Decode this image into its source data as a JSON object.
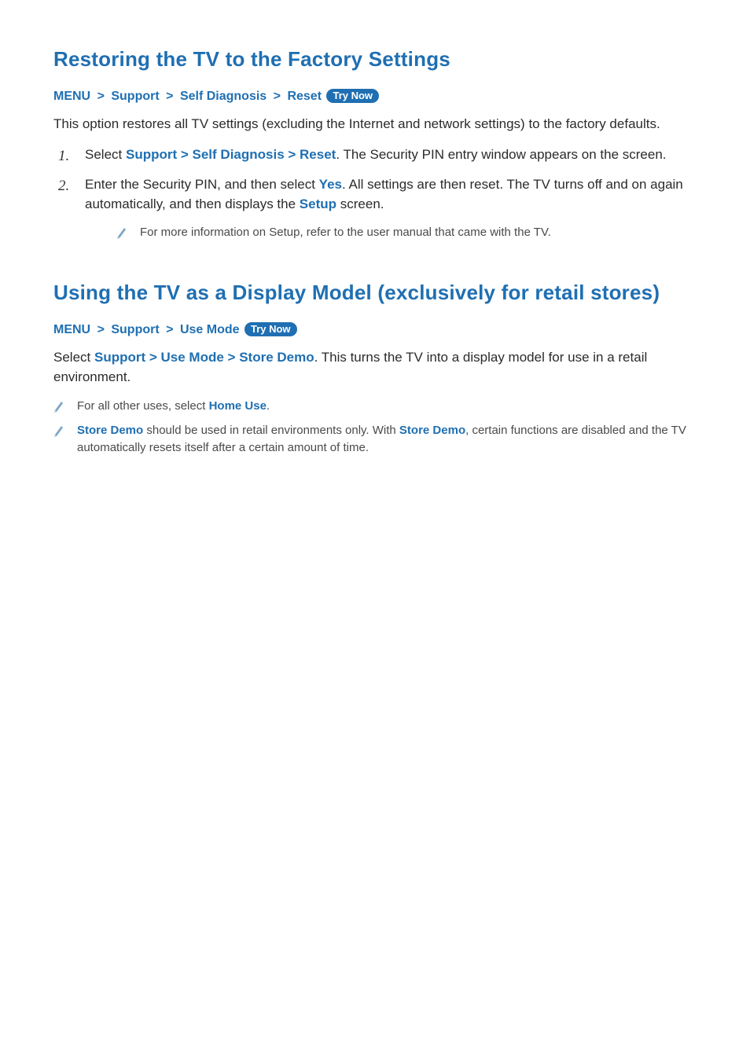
{
  "section1": {
    "title": "Restoring the TV to the Factory Settings",
    "menu_label": "MENU",
    "path_item1": "Support",
    "path_item2": "Self Diagnosis",
    "path_item3": "Reset",
    "trynow": "Try Now",
    "intro": "This option restores all TV settings (excluding the Internet and network settings) to the factory defaults.",
    "step1_pre": "Select ",
    "step1_kw1": "Support",
    "step1_kw2": "Self Diagnosis",
    "step1_kw3": "Reset",
    "step1_post": ". The Security PIN entry window appears on the screen.",
    "step2_pre": "Enter the Security PIN, and then select ",
    "step2_kw1": "Yes",
    "step2_mid": ". All settings are then reset. The TV turns off and on again automatically, and then displays the ",
    "step2_kw2": "Setup",
    "step2_post": " screen.",
    "note1": "For more information on Setup, refer to the user manual that came with the TV."
  },
  "section2": {
    "title": "Using the TV as a Display Model (exclusively for retail stores)",
    "menu_label": "MENU",
    "path_item1": "Support",
    "path_item2": "Use Mode",
    "trynow": "Try Now",
    "para_pre": "Select ",
    "para_kw1": "Support",
    "para_kw2": "Use Mode",
    "para_kw3": "Store Demo",
    "para_post": ". This turns the TV into a display model for use in a retail environment.",
    "note1_pre": "For all other uses, select ",
    "note1_kw": "Home Use",
    "note1_post": ".",
    "note2_kw1": "Store Demo",
    "note2_mid1": " should be used in retail environments only. With ",
    "note2_kw2": "Store Demo",
    "note2_post": ", certain functions are disabled and the TV automatically resets itself after a certain amount of time."
  },
  "glyphs": {
    "chevron": ">"
  }
}
